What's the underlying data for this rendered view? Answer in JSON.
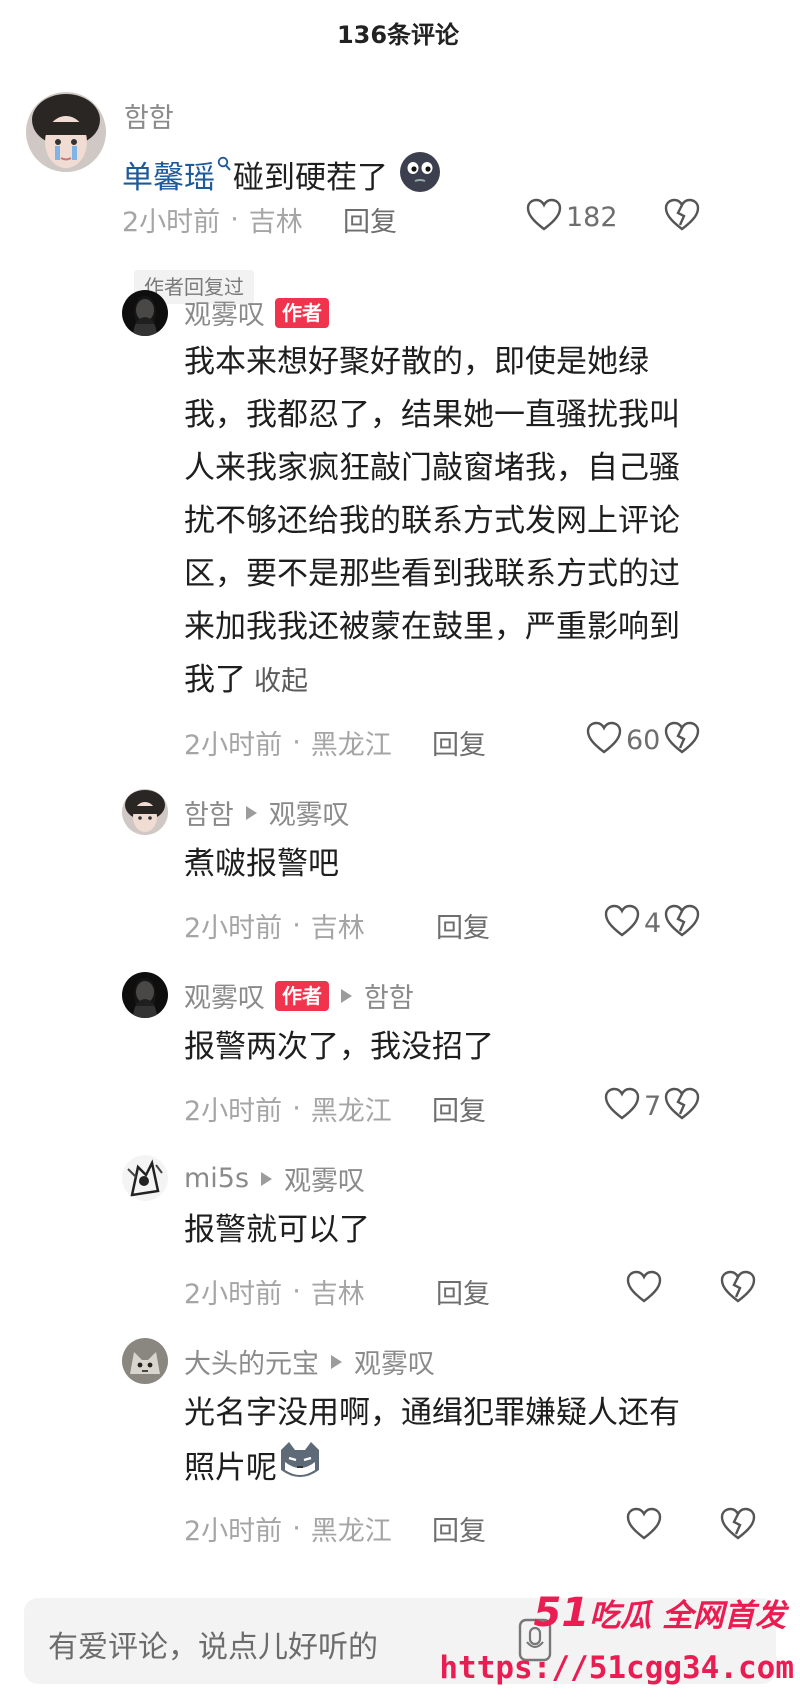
{
  "header": {
    "title": "136条评论"
  },
  "comments": [
    {
      "username": "함함",
      "mention": "单馨瑶",
      "text": "碰到硬茬了",
      "time": "2小时前",
      "location": "吉林",
      "reply_label": "回复",
      "likes": "182",
      "author_replied": "作者回复过"
    },
    {
      "username": "观雾叹",
      "badge": "作者",
      "text_lines": [
        "我本来想好聚好散的，即使是她绿",
        "我，我都忍了，结果她一直骚扰我叫",
        "人来我家疯狂敲门敲窗堵我，自己骚",
        "扰不够还给我的联系方式发网上评论",
        "区，要不是那些看到我联系方式的过",
        "来加我我还被蒙在鼓里，严重影响到",
        "我了"
      ],
      "collapse": "收起",
      "time": "2小时前",
      "location": "黑龙江",
      "reply_label": "回复",
      "likes": "60"
    },
    {
      "username": "함함",
      "target": "观雾叹",
      "text": "煮啵报警吧",
      "time": "2小时前",
      "location": "吉林",
      "reply_label": "回复",
      "likes": "4"
    },
    {
      "username": "观雾叹",
      "badge": "作者",
      "target": "함함",
      "text": "报警两次了，我没招了",
      "time": "2小时前",
      "location": "黑龙江",
      "reply_label": "回复",
      "likes": "7"
    },
    {
      "username": "mi5s",
      "target": "观雾叹",
      "text": "报警就可以了",
      "time": "2小时前",
      "location": "吉林",
      "reply_label": "回复",
      "likes": ""
    },
    {
      "username": "大头的元宝",
      "target": "观雾叹",
      "text_lines": [
        "光名字没用啊，通缉犯罪嫌疑人还有",
        "照片呢"
      ],
      "time": "2小时前",
      "location": "黑龙江",
      "reply_label": "回复",
      "likes": ""
    }
  ],
  "separator": "·",
  "input": {
    "placeholder": "有爱评论，说点儿好听的"
  },
  "watermark": {
    "logo_big": "51",
    "logo_text": "吃瓜 全网首发",
    "url": "https://51cgg34.com"
  },
  "colors": {
    "badge": "#f0344e",
    "mention": "#1d5a9c",
    "watermark": "#ea1d52"
  }
}
